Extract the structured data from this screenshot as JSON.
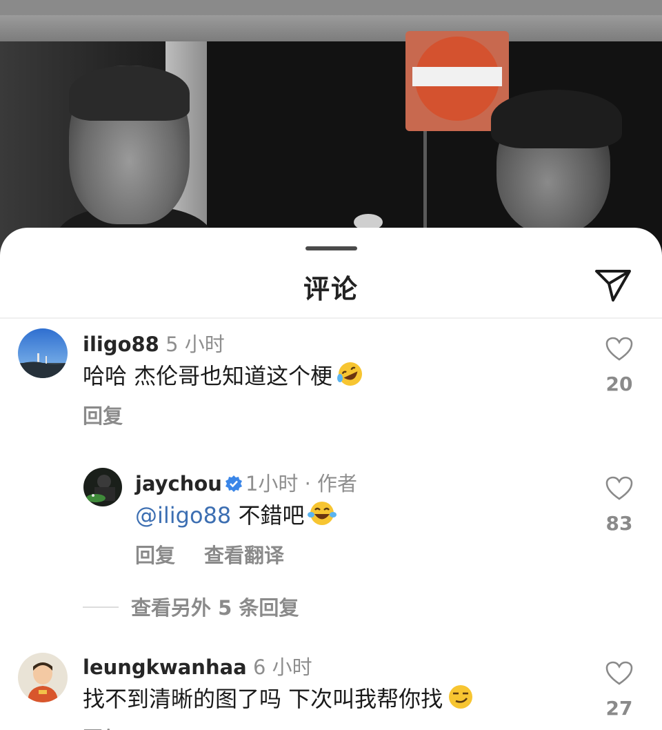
{
  "sheet": {
    "title": "评论"
  },
  "comments": [
    {
      "username": "iligo88",
      "time": "5 小时",
      "text": "哈哈 杰伦哥也知道这个梗",
      "emoji_icon": "rolling-on-floor-laughing-emoji",
      "reply_label": "回复",
      "like_count": "20"
    },
    {
      "username": "jaychou",
      "verified": true,
      "time": "1小时 · 作者",
      "mention": "@iligo88",
      "text": " 不錯吧",
      "emoji_icon": "tears-of-joy-emoji",
      "reply_label": "回复",
      "translate_label": "查看翻译",
      "like_count": "83"
    },
    {
      "username": "leungkwanhaa",
      "time": "6 小时",
      "text": "找不到清晰的图了吗 下次叫我帮你找",
      "emoji_icon": "smirking-face-emoji",
      "reply_label": "回复",
      "like_count": "27"
    }
  ],
  "view_more_replies": "查看另外 5 条回复",
  "colors": {
    "mention": "#3d6fb2",
    "verified": "#3a86e8",
    "muted": "#8a8a8a"
  }
}
